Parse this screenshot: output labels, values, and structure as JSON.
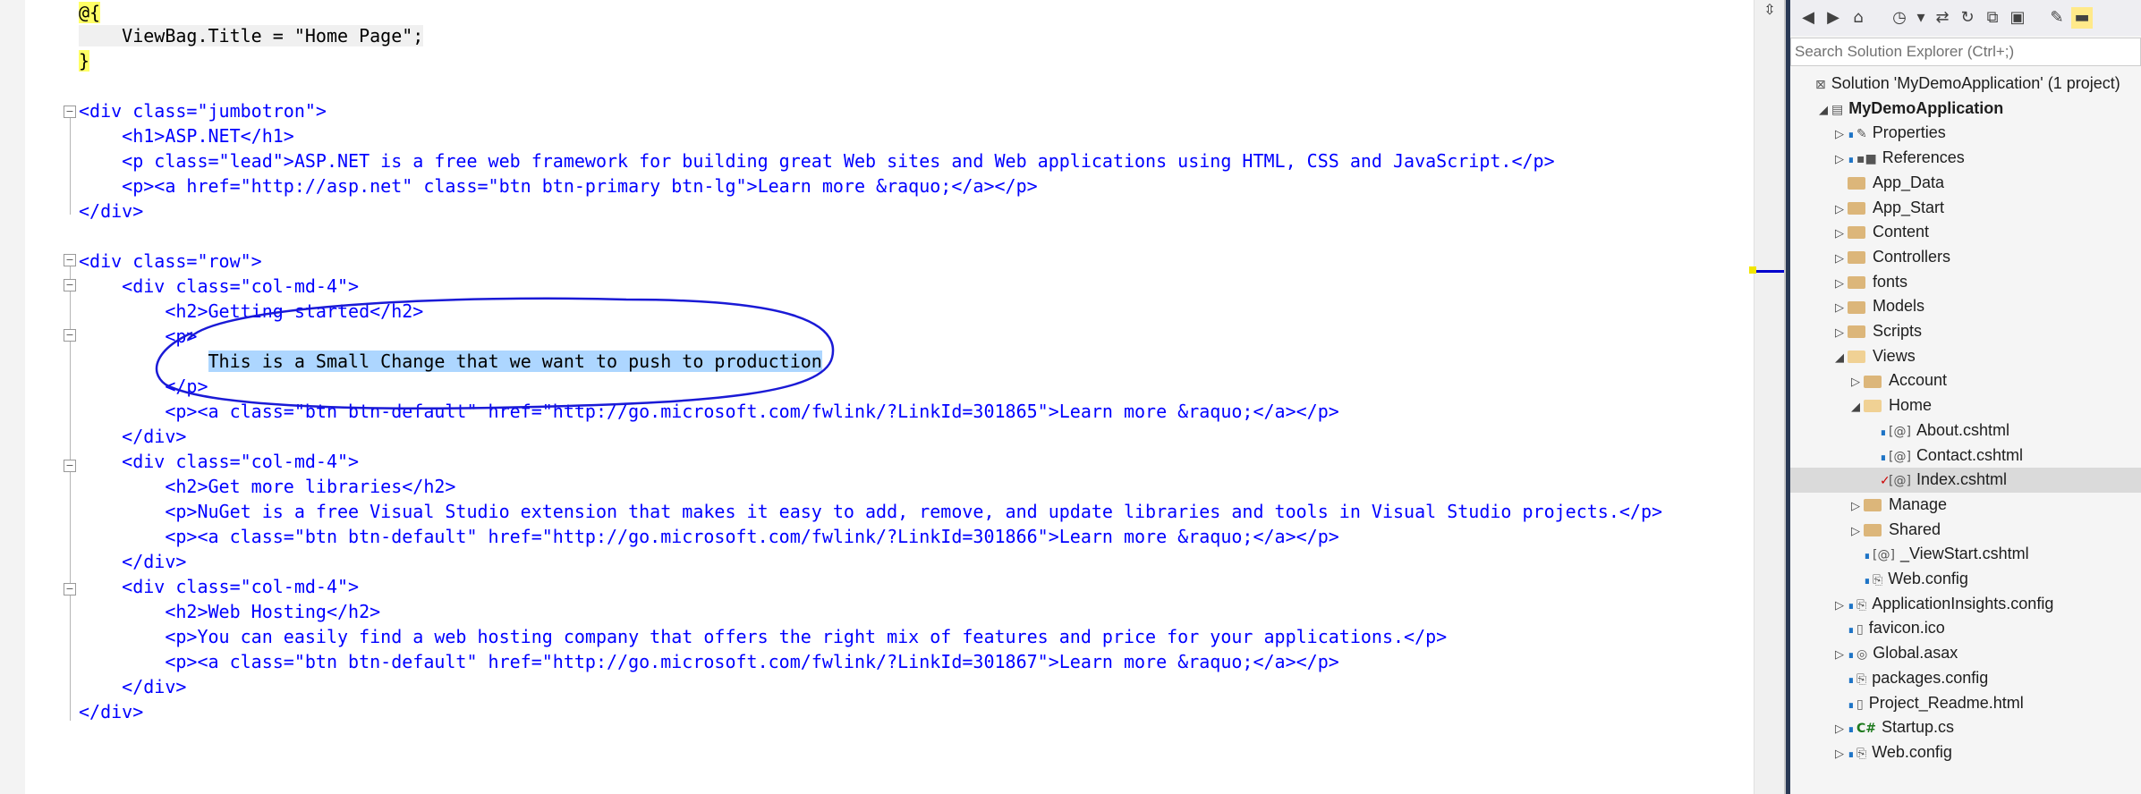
{
  "editor": {
    "lines": [
      {
        "text": "@{"
      },
      {
        "text": "    ViewBag.Title = \"Home Page\";"
      },
      {
        "text": "}"
      },
      {
        "text": ""
      },
      {
        "text": "<div class=\"jumbotron\">"
      },
      {
        "text": "    <h1>ASP.NET</h1>"
      },
      {
        "text": "    <p class=\"lead\">ASP.NET is a free web framework for building great Web sites and Web applications using HTML, CSS and JavaScript.</p>"
      },
      {
        "text": "    <p><a href=\"http://asp.net\" class=\"btn btn-primary btn-lg\">Learn more &raquo;</a></p>"
      },
      {
        "text": "</div>"
      },
      {
        "text": ""
      },
      {
        "text": "<div class=\"row\">"
      },
      {
        "text": "    <div class=\"col-md-4\">"
      },
      {
        "text": "        <h2>Getting started</h2>"
      },
      {
        "text": "        <p>"
      },
      {
        "text": "            This is a Small Change that we want to push to production"
      },
      {
        "text": "        </p>"
      },
      {
        "text": "        <p><a class=\"btn btn-default\" href=\"http://go.microsoft.com/fwlink/?LinkId=301865\">Learn more &raquo;</a></p>"
      },
      {
        "text": "    </div>"
      },
      {
        "text": "    <div class=\"col-md-4\">"
      },
      {
        "text": "        <h2>Get more libraries</h2>"
      },
      {
        "text": "        <p>NuGet is a free Visual Studio extension that makes it easy to add, remove, and update libraries and tools in Visual Studio projects.</p>"
      },
      {
        "text": "        <p><a class=\"btn btn-default\" href=\"http://go.microsoft.com/fwlink/?LinkId=301866\">Learn more &raquo;</a></p>"
      },
      {
        "text": "    </div>"
      },
      {
        "text": "    <div class=\"col-md-4\">"
      },
      {
        "text": "        <h2>Web Hosting</h2>"
      },
      {
        "text": "        <p>You can easily find a web hosting company that offers the right mix of features and price for your applications.</p>"
      },
      {
        "text": "        <p><a class=\"btn btn-default\" href=\"http://go.microsoft.com/fwlink/?LinkId=301867\">Learn more &raquo;</a></p>"
      },
      {
        "text": "    </div>"
      },
      {
        "text": "</div>"
      }
    ],
    "selected_text": "This is a Small Change that we want to push to production"
  },
  "solution_explorer": {
    "search_placeholder": "Search Solution Explorer (Ctrl+;)",
    "items": [
      {
        "label": "Solution 'MyDemoApplication' (1 project)",
        "bold": false,
        "icon": "solution-icon"
      },
      {
        "label": "MyDemoApplication",
        "bold": true,
        "icon": "project-icon"
      },
      {
        "label": "Properties",
        "icon": "wrench-icon"
      },
      {
        "label": "References",
        "icon": "references-icon"
      },
      {
        "label": "App_Data",
        "icon": "folder-icon"
      },
      {
        "label": "App_Start",
        "icon": "folder-icon"
      },
      {
        "label": "Content",
        "icon": "folder-icon"
      },
      {
        "label": "Controllers",
        "icon": "folder-icon"
      },
      {
        "label": "fonts",
        "icon": "folder-icon"
      },
      {
        "label": "Models",
        "icon": "folder-icon"
      },
      {
        "label": "Scripts",
        "icon": "folder-icon"
      },
      {
        "label": "Views",
        "icon": "folder-open-icon"
      },
      {
        "label": "Account",
        "icon": "folder-icon"
      },
      {
        "label": "Home",
        "icon": "folder-open-icon"
      },
      {
        "label": "About.cshtml",
        "icon": "razor-file-icon"
      },
      {
        "label": "Contact.cshtml",
        "icon": "razor-file-icon"
      },
      {
        "label": "Index.cshtml",
        "icon": "razor-file-icon",
        "selected": true,
        "modified": true
      },
      {
        "label": "Manage",
        "icon": "folder-icon"
      },
      {
        "label": "Shared",
        "icon": "folder-icon"
      },
      {
        "label": "_ViewStart.cshtml",
        "icon": "razor-file-icon"
      },
      {
        "label": "Web.config",
        "icon": "config-icon"
      },
      {
        "label": "ApplicationInsights.config",
        "icon": "config-icon"
      },
      {
        "label": "favicon.ico",
        "icon": "file-icon"
      },
      {
        "label": "Global.asax",
        "icon": "global-icon"
      },
      {
        "label": "packages.config",
        "icon": "config-icon"
      },
      {
        "label": "Project_Readme.html",
        "icon": "html-file-icon"
      },
      {
        "label": "Startup.cs",
        "icon": "csharp-icon"
      },
      {
        "label": "Web.config",
        "icon": "config-icon"
      }
    ]
  },
  "colors": {
    "tag": "#800000",
    "attribute": "#ff0000",
    "string": "#0000ff",
    "selection": "#add6ff",
    "annotation": "#1a1ad6",
    "selected_row": "#dadada"
  }
}
